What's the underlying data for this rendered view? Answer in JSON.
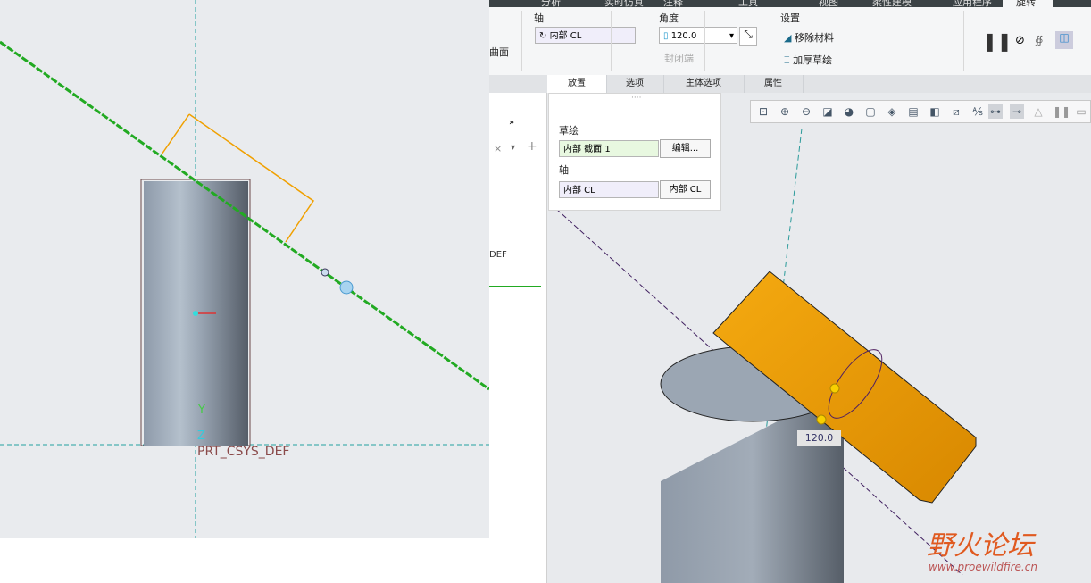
{
  "menu_tabs": [
    "分析",
    "实时仿真",
    "注释",
    "工具",
    "视图",
    "柔性建模",
    "应用程序",
    "旋转"
  ],
  "ribbon": {
    "surface_label": "曲面",
    "axis_group": "轴",
    "axis_value": "内部 CL",
    "angle_group": "角度",
    "angle_value": "120.0",
    "cap_ends": "封闭端",
    "settings_group": "设置",
    "remove_material": "移除材料",
    "thicken_sketch": "加厚草绘"
  },
  "sub_tabs": [
    "放置",
    "选项",
    "主体选项",
    "属性"
  ],
  "placement": {
    "sketch_label": "草绘",
    "sketch_value": "内部 截面 1",
    "edit_button": "编辑...",
    "axis_label": "轴",
    "axis_value": "内部 CL",
    "axis_button": "内部 CL"
  },
  "left_view": {
    "csys_label": "PRT_CSYS_DEF",
    "y_label": "Y",
    "z_label": "Z"
  },
  "right_view": {
    "dimension": "120.0",
    "partial_label": "DEF"
  },
  "watermark": {
    "title": "野火论坛",
    "url": "www.proewildfire.cn"
  },
  "colors": {
    "feature": "#f0a000",
    "axis": "#22aa22",
    "model": "#8a96a6"
  }
}
